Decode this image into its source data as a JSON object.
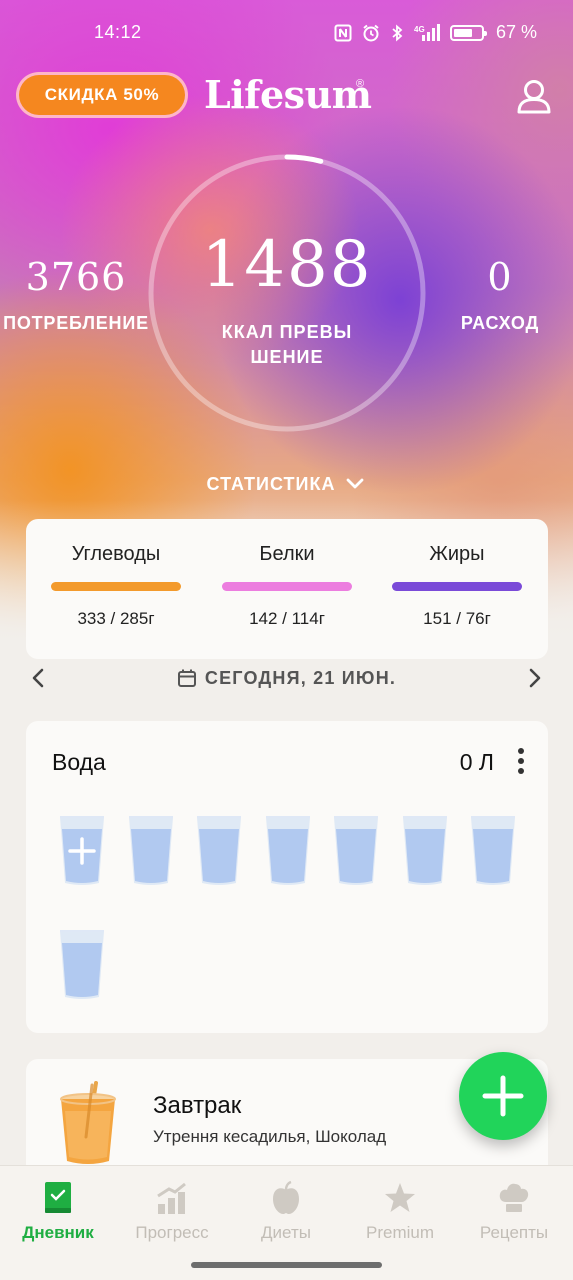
{
  "status_bar": {
    "time": "14:12",
    "battery_text": "67 %",
    "signal_text": "4G",
    "icons": [
      "nfc-icon",
      "alarm-icon",
      "bluetooth-icon",
      "signal-icon",
      "battery-icon"
    ]
  },
  "header": {
    "discount_label": "СКИДКА 50%",
    "logo": "Lifesum",
    "logo_mark": "®",
    "profile_icon": "profile-icon"
  },
  "summary": {
    "intake_value": "3766",
    "intake_label": "ПОТРЕБЛЕНИЕ",
    "kcal_value": "1488",
    "kcal_label": "ККАЛ ПРЕВЫ ШЕНИЕ",
    "burned_value": "0",
    "burned_label": "РАСХОД",
    "ring_progress": 0.04,
    "stats_toggle": "СТАТИСТИКА"
  },
  "macros": [
    {
      "name": "Углеводы",
      "value": "333 / 285г",
      "color": "#f39a2c"
    },
    {
      "name": "Белки",
      "value": "142 / 114г",
      "color": "#ec7ddf"
    },
    {
      "name": "Жиры",
      "value": "151 / 76г",
      "color": "#7a4ad8"
    }
  ],
  "date_nav": {
    "label": "СЕГОДНЯ, 21 ИЮН."
  },
  "water": {
    "title": "Вода",
    "amount": "0 Л",
    "glass_count": 8
  },
  "meal": {
    "title": "Завтрак",
    "subtitle": "Утрення кесадилья, Шоколад"
  },
  "bottom_nav": [
    {
      "label": "Дневник",
      "icon": "diary-icon",
      "active": true
    },
    {
      "label": "Прогресс",
      "icon": "progress-icon",
      "active": false
    },
    {
      "label": "Диеты",
      "icon": "apple-icon",
      "active": false
    },
    {
      "label": "Premium",
      "icon": "star-icon",
      "active": false
    },
    {
      "label": "Рецепты",
      "icon": "chef-hat-icon",
      "active": false
    }
  ],
  "colors": {
    "accent_green": "#21d45a",
    "discount_orange": "#f5871f",
    "nav_active": "#1fae42"
  }
}
